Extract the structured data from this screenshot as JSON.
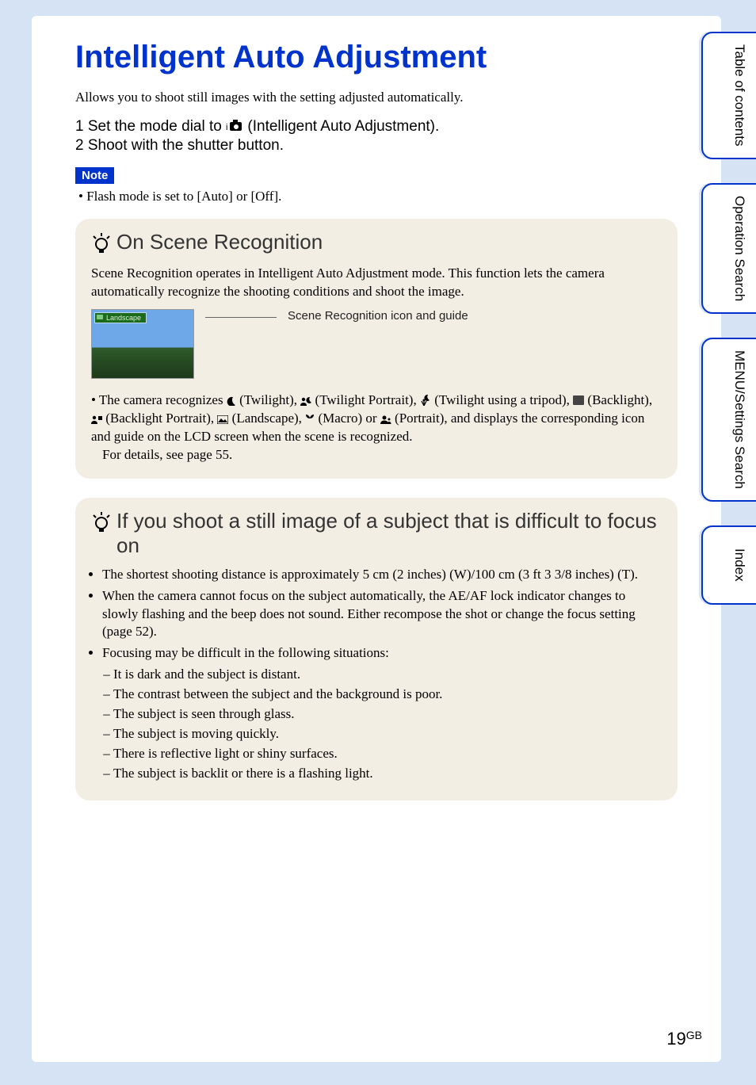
{
  "title": "Intelligent Auto Adjustment",
  "intro": "Allows you to shoot still images with the setting adjusted automatically.",
  "steps": {
    "s1_pre": "1  Set the mode dial to ",
    "s1_post": " (Intelligent Auto Adjustment).",
    "s2": "2  Shoot with the shutter button."
  },
  "note_label": "Note",
  "note_text": "•  Flash mode is set to [Auto] or [Off].",
  "tip1": {
    "heading": "On Scene Recognition",
    "body": "Scene Recognition operates in Intelligent Auto Adjustment mode. This function lets the camera automatically recognize the shooting conditions and shoot the image.",
    "scene_label": "Landscape",
    "scene_caption": "Scene Recognition icon and guide",
    "rec_pre": "•  The camera recognizes ",
    "rec_tw": " (Twilight), ",
    "rec_twp": " (Twilight Portrait), ",
    "rec_twt": " (Twilight using a tripod), ",
    "rec_bl": " (Backlight), ",
    "rec_blp": " (Backlight Portrait), ",
    "rec_ls": " (Landscape), ",
    "rec_mc": " (Macro) or ",
    "rec_pt": " (Portrait), and displays the corresponding icon and guide on the LCD screen when the scene is recognized.",
    "rec_detail": "For details, see page 55."
  },
  "tip2": {
    "heading": "If you shoot a still image of a subject that is difficult to focus on",
    "b1": "The shortest shooting distance is approximately 5 cm (2 inches) (W)/100 cm (3 ft 3 3/8 inches) (T).",
    "b2": "When the camera cannot focus on the subject automatically, the AE/AF lock indicator changes to slowly flashing and the beep does not sound. Either recompose the shot or change the focus setting (page 52).",
    "b3": "Focusing may be difficult in the following situations:",
    "s1": "It is dark and the subject is distant.",
    "s2": "The contrast between the subject and the background is poor.",
    "s3": "The subject is seen through glass.",
    "s4": "The subject is moving quickly.",
    "s5": "There is reflective light or shiny surfaces.",
    "s6": "The subject is backlit or there is a flashing light."
  },
  "tabs": {
    "t1": "Table of contents",
    "t2": "Operation Search",
    "t3": "MENU/Settings Search",
    "t4": "Index"
  },
  "page_number": "19",
  "page_suffix": "GB"
}
